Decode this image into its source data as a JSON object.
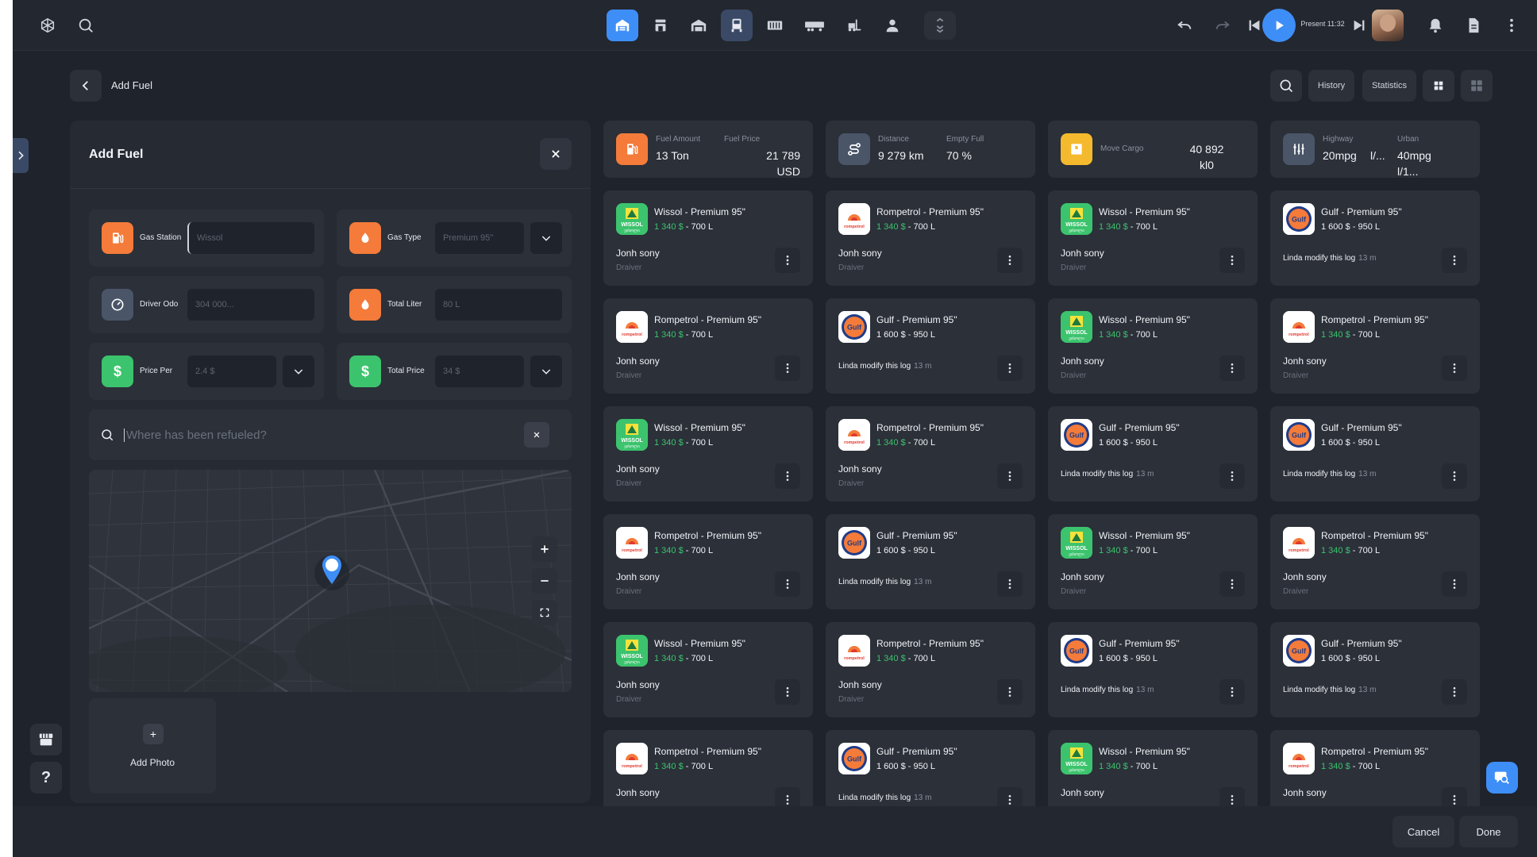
{
  "header": {
    "title": "Add Fuel",
    "history_label": "History",
    "statistics_label": "Statistics",
    "present_label": "Present 11:32"
  },
  "form": {
    "title": "Add Fuel",
    "gas_station": {
      "label": "Gas Station",
      "placeholder": "Wissol"
    },
    "gas_type": {
      "label": "Gas Type",
      "placeholder": "Premium 95\""
    },
    "driver_odo": {
      "label": "Driver Odo",
      "placeholder": "304 000..."
    },
    "total_liter": {
      "label": "Total Liter",
      "placeholder": "80 L"
    },
    "price_per": {
      "label": "Price Per",
      "placeholder": "2.4 $"
    },
    "total_price": {
      "label": "Total Price",
      "placeholder": "34 $"
    },
    "search_placeholder": "Where has been refueled?",
    "add_photo_label": "Add Photo"
  },
  "summary": [
    {
      "k1": "Fuel Amount",
      "v1": "13 Ton",
      "k2": "Fuel Price",
      "v2a": "21 789",
      "v2b": "USD",
      "icon": "fuel-pump-icon",
      "color": "#f47b3a"
    },
    {
      "k1": "Distance",
      "v1": "9 279 km",
      "k2": "Empty Full",
      "v2a": "70 %",
      "v2b": "",
      "icon": "route-icon",
      "color": "#4a5568"
    },
    {
      "k1": "Move Cargo",
      "v1": "",
      "k2": "",
      "v2a": "40 892",
      "v2b": "kl0",
      "icon": "cargo-box-icon",
      "color": "#f5b92e"
    },
    {
      "k1": "Highway",
      "v1": "20mpg",
      "k1b": "l/...",
      "k2": "Urban",
      "v2a": "40mpg",
      "v2b": "l/1...",
      "icon": "gauge-lines-icon",
      "color": "#4a5568"
    }
  ],
  "logs": [
    [
      {
        "brand": "wissol",
        "title": "Wissol - Premium 95\"",
        "p1": "1 340",
        "p2": "700",
        "who": "Jonh sony",
        "role": "Draiver"
      },
      {
        "brand": "rompetrol",
        "title": "Rompetrol - Premium 95\"",
        "p1": "1 340",
        "p2": "700",
        "who": "Jonh sony",
        "role": "Draiver"
      },
      {
        "brand": "wissol",
        "title": "Wissol - Premium 95\"",
        "p1": "1 340",
        "p2": "700",
        "who": "Jonh sony",
        "role": "Draiver"
      },
      {
        "brand": "gulf",
        "title": "Gulf - Premium 95\"",
        "p1": "1 600",
        "p2": "950",
        "mod": "Linda modify this log",
        "ago": "13 m"
      }
    ],
    [
      {
        "brand": "rompetrol",
        "title": "Rompetrol - Premium 95\"",
        "p1": "1 340",
        "p2": "700",
        "who": "Jonh sony",
        "role": "Draiver"
      },
      {
        "brand": "gulf",
        "title": "Gulf - Premium 95\"",
        "p1": "1 600",
        "p2": "950",
        "mod": "Linda modify this log",
        "ago": "13 m"
      },
      {
        "brand": "wissol",
        "title": "Wissol - Premium 95\"",
        "p1": "1 340",
        "p2": "700",
        "who": "Jonh sony",
        "role": "Draiver"
      },
      {
        "brand": "rompetrol",
        "title": "Rompetrol - Premium 95\"",
        "p1": "1 340",
        "p2": "700",
        "who": "Jonh sony",
        "role": "Draiver"
      }
    ],
    [
      {
        "brand": "wissol",
        "title": "Wissol - Premium 95\"",
        "p1": "1 340",
        "p2": "700",
        "who": "Jonh sony",
        "role": "Draiver"
      },
      {
        "brand": "rompetrol",
        "title": "Rompetrol - Premium 95\"",
        "p1": "1 340",
        "p2": "700",
        "who": "Jonh sony",
        "role": "Draiver"
      },
      {
        "brand": "gulf",
        "title": "Gulf - Premium 95\"",
        "p1": "1 600",
        "p2": "950",
        "mod": "Linda modify this log",
        "ago": "13 m"
      },
      {
        "brand": "gulf",
        "title": "Gulf - Premium 95\"",
        "p1": "1 600",
        "p2": "950",
        "mod": "Linda modify this log",
        "ago": "13 m"
      }
    ],
    [
      {
        "brand": "rompetrol",
        "title": "Rompetrol - Premium 95\"",
        "p1": "1 340",
        "p2": "700",
        "who": "Jonh sony",
        "role": "Draiver"
      },
      {
        "brand": "gulf",
        "title": "Gulf - Premium 95\"",
        "p1": "1 600",
        "p2": "950",
        "mod": "Linda modify this log",
        "ago": "13 m"
      },
      {
        "brand": "wissol",
        "title": "Wissol - Premium 95\"",
        "p1": "1 340",
        "p2": "700",
        "who": "Jonh sony",
        "role": "Draiver"
      },
      {
        "brand": "rompetrol",
        "title": "Rompetrol - Premium 95\"",
        "p1": "1 340",
        "p2": "700",
        "who": "Jonh sony",
        "role": "Draiver"
      }
    ],
    [
      {
        "brand": "wissol",
        "title": "Wissol - Premium 95\"",
        "p1": "1 340",
        "p2": "700",
        "who": "Jonh sony",
        "role": "Draiver"
      },
      {
        "brand": "rompetrol",
        "title": "Rompetrol - Premium 95\"",
        "p1": "1 340",
        "p2": "700",
        "who": "Jonh sony",
        "role": "Draiver"
      },
      {
        "brand": "gulf",
        "title": "Gulf - Premium 95\"",
        "p1": "1 600",
        "p2": "950",
        "mod": "Linda modify this log",
        "ago": "13 m"
      },
      {
        "brand": "gulf",
        "title": "Gulf - Premium 95\"",
        "p1": "1 600",
        "p2": "950",
        "mod": "Linda modify this log",
        "ago": "13 m"
      }
    ],
    [
      {
        "brand": "rompetrol",
        "title": "Rompetrol - Premium 95\"",
        "p1": "1 340",
        "p2": "700",
        "who": "Jonh sony",
        "role": ""
      },
      {
        "brand": "gulf",
        "title": "Gulf - Premium 95\"",
        "p1": "1 600",
        "p2": "950",
        "mod": "Linda modify this log",
        "ago": "13 m"
      },
      {
        "brand": "wissol",
        "title": "Wissol - Premium 95\"",
        "p1": "1 340",
        "p2": "700",
        "who": "Jonh sony",
        "role": ""
      },
      {
        "brand": "rompetrol",
        "title": "Rompetrol - Premium 95\"",
        "p1": "1 340",
        "p2": "700",
        "who": "Jonh sony",
        "role": ""
      }
    ]
  ],
  "currency": "$",
  "liter_unit": "L",
  "brand_logos": {
    "wissol": "WISSOL",
    "rompetrol": "rompetrol",
    "gulf": "Gulf"
  },
  "footer": {
    "cancel_label": "Cancel",
    "done_label": "Done"
  },
  "colors": {
    "accent": "#3e8ef7",
    "orange": "#f47b3a",
    "green": "#3cc36d",
    "bg": "#1f232c",
    "card": "#2b3039"
  }
}
